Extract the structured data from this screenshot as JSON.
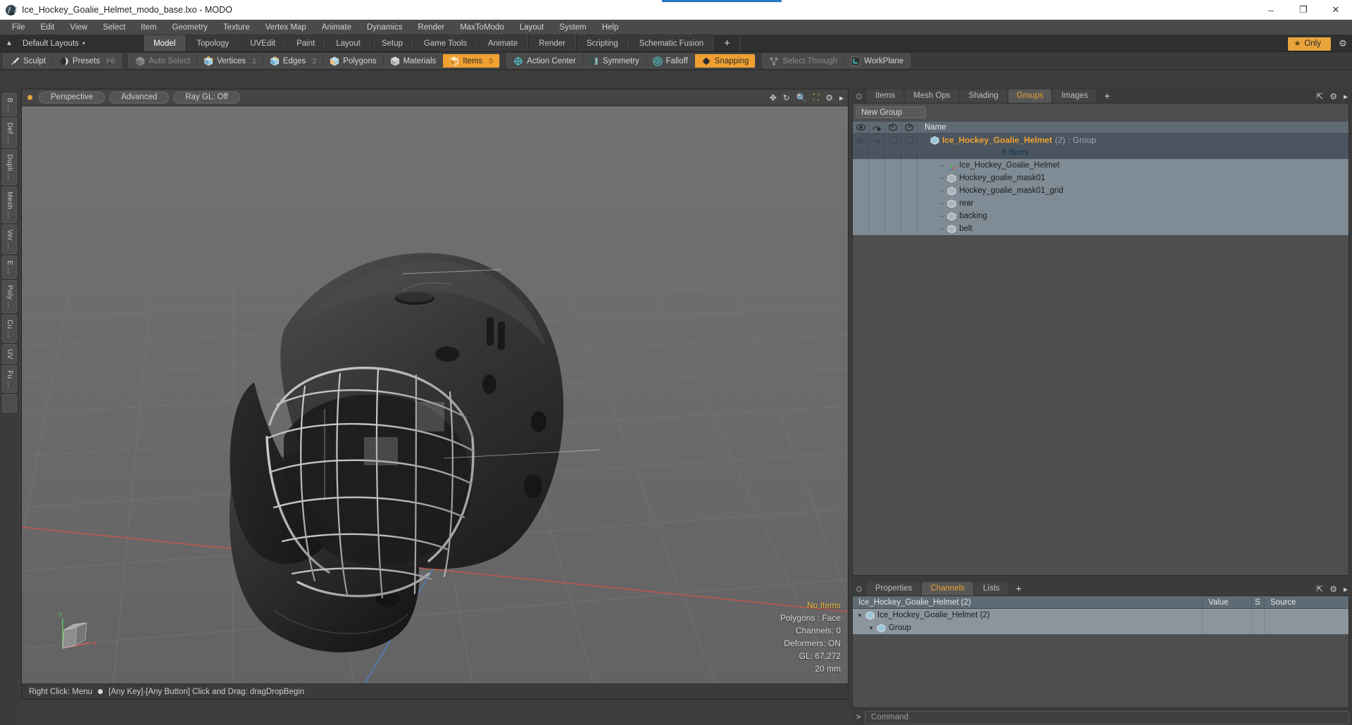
{
  "window": {
    "title": "Ice_Hockey_Goalie_Helmet_modo_base.lxo - MODO",
    "minimize": "–",
    "maximize": "❐",
    "close": "✕"
  },
  "menubar": {
    "items": [
      "File",
      "Edit",
      "View",
      "Select",
      "Item",
      "Geometry",
      "Texture",
      "Vertex Map",
      "Animate",
      "Dynamics",
      "Render",
      "MaxToModo",
      "Layout",
      "System",
      "Help"
    ]
  },
  "layoutbar": {
    "default_layouts": "Default Layouts",
    "caret": "▾",
    "up_icon": "▲",
    "tabs": [
      {
        "label": "Model",
        "active": true
      },
      {
        "label": "Topology",
        "active": false
      },
      {
        "label": "UVEdit",
        "active": false
      },
      {
        "label": "Paint",
        "active": false
      },
      {
        "label": "Layout",
        "active": false
      },
      {
        "label": "Setup",
        "active": false
      },
      {
        "label": "Game Tools",
        "active": false
      },
      {
        "label": "Animate",
        "active": false
      },
      {
        "label": "Render",
        "active": false
      },
      {
        "label": "Scripting",
        "active": false
      },
      {
        "label": "Schematic Fusion",
        "active": false
      }
    ],
    "add_tab": "+",
    "only_label": "Only",
    "only_star": "★",
    "gear": "⚙"
  },
  "modebar": {
    "group1": [
      {
        "label": "Sculpt",
        "icon": "brush-icon",
        "state": "normal",
        "key": ""
      },
      {
        "label": "Presets",
        "icon": "sphere-icon",
        "state": "normal",
        "key": "F6"
      }
    ],
    "group2": [
      {
        "label": "Auto Select",
        "icon": "cube-grey-icon",
        "state": "dim",
        "key": ""
      },
      {
        "label": "Vertices",
        "icon": "vertices-icon",
        "state": "normal",
        "key": "1"
      },
      {
        "label": "Edges",
        "icon": "edges-icon",
        "state": "normal",
        "key": "2"
      },
      {
        "label": "Polygons",
        "icon": "polygons-icon",
        "state": "normal",
        "key": ""
      },
      {
        "label": "Materials",
        "icon": "materials-icon",
        "state": "normal",
        "key": ""
      },
      {
        "label": "Items",
        "icon": "items-icon",
        "state": "on",
        "key": "5"
      }
    ],
    "group3": [
      {
        "label": "Action Center",
        "icon": "action-center-icon",
        "state": "normal",
        "key": ""
      },
      {
        "label": "Symmetry",
        "icon": "symmetry-icon",
        "state": "normal",
        "key": ""
      },
      {
        "label": "Falloff",
        "icon": "falloff-icon",
        "state": "normal",
        "key": ""
      },
      {
        "label": "Snapping",
        "icon": "snapping-icon",
        "state": "on",
        "key": ""
      }
    ],
    "group4": [
      {
        "label": "Select Through",
        "icon": "select-through-icon",
        "state": "dim",
        "key": ""
      },
      {
        "label": "WorkPlane",
        "icon": "workplane-icon",
        "state": "normal",
        "key": ""
      }
    ]
  },
  "vrail": {
    "tabs": [
      "B ...",
      "Def ...",
      "Dupli ...",
      "Mesh ...",
      "Ver ...",
      "E ...",
      "Poly ...",
      "Cu ...",
      "UV",
      "Fu ..."
    ]
  },
  "viewport": {
    "pills": [
      "Perspective",
      "Advanced",
      "Ray GL: Off"
    ],
    "header_icons": [
      "move-icon",
      "refresh-icon",
      "zoom-icon",
      "fit-icon",
      "chevron-right-icon"
    ],
    "info": {
      "selection": "No Items",
      "polygons": "Polygons : Face",
      "channels": "Channels: 0",
      "deformers": "Deformers: ON",
      "gl": "GL: 67,272",
      "scale": "20 mm"
    },
    "axis": {
      "y": "Y",
      "x": "X"
    },
    "footer": "Right Click: Menu ● [Any Key]-[Any Button] Click and Drag: dragDropBegin",
    "footer_part1": "Right Click: Menu",
    "footer_part2": "[Any Key]-[Any Button] Click and Drag: dragDropBegin"
  },
  "rightdock": {
    "tabs": [
      {
        "label": "Items",
        "active": false
      },
      {
        "label": "Mesh Ops",
        "active": false
      },
      {
        "label": "Shading",
        "active": false
      },
      {
        "label": "Groups",
        "active": true
      },
      {
        "label": "Images",
        "active": false
      }
    ],
    "add_tab": "+",
    "corner_icons": [
      "expand-icon",
      "gear-icon",
      "chevron-right-icon"
    ],
    "new_group_button": "New Group",
    "list_header": {
      "columns": [
        "eye-icon",
        "render-cam-icon",
        "shaded-cube-icon",
        "wire-cube-icon"
      ],
      "name": "Name"
    },
    "group_row": {
      "name": "Ice_Hockey_Goalie_Helmet",
      "count": "(2)",
      "type": ": Group",
      "items_label": "6 Items",
      "icon": "group-cube-icon"
    },
    "children": [
      {
        "label": "Ice_Hockey_Goalie_Helmet",
        "icon": "locator-axis-icon"
      },
      {
        "label": "Hockey_goalie_mask01",
        "icon": "mesh-cube-icon"
      },
      {
        "label": "Hockey_goalie_mask01_grid",
        "icon": "mesh-cube-icon"
      },
      {
        "label": "rear",
        "icon": "mesh-cube-icon"
      },
      {
        "label": "backing",
        "icon": "mesh-cube-icon"
      },
      {
        "label": "belt",
        "icon": "mesh-cube-icon"
      }
    ]
  },
  "channels": {
    "tabs": [
      {
        "label": "Properties",
        "active": false
      },
      {
        "label": "Channels",
        "active": true
      },
      {
        "label": "Lists",
        "active": false
      }
    ],
    "add_tab": "+",
    "corner_icons": [
      "expand-icon",
      "gear-icon",
      "chevron-right-icon"
    ],
    "header": {
      "name": "Ice_Hockey_Goalie_Helmet (2)",
      "value": "Value",
      "s": "S",
      "source": "Source"
    },
    "rows": [
      {
        "label": "Ice_Hockey_Goalie_Helmet (2)",
        "indent": 0,
        "icon": "group-cube-icon",
        "expanded": true
      },
      {
        "label": "Group",
        "indent": 1,
        "icon": "group-cube-icon",
        "expanded": true
      }
    ]
  },
  "commandbar": {
    "prompt": ">",
    "placeholder": "Command",
    "value": ""
  },
  "colors": {
    "accent": "#f0a030",
    "panel": "#3b3b3b",
    "list_bg": "#7f8b95",
    "header_blue": "#5f6b74",
    "title_bar": "#ffffff"
  }
}
